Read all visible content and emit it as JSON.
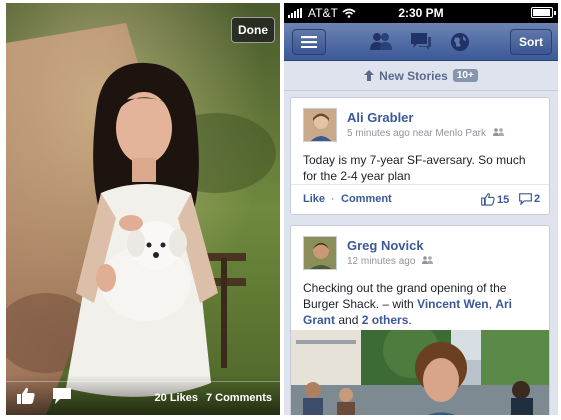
{
  "photo_viewer": {
    "done_label": "Done",
    "likes_text": "20 Likes",
    "comments_text": "7 Comments"
  },
  "status_bar": {
    "carrier": "AT&T",
    "time": "2:30 PM"
  },
  "nav": {
    "sort_label": "Sort",
    "icons": [
      "menu-icon",
      "friends-icon",
      "messages-icon",
      "globe-icon"
    ]
  },
  "banner": {
    "label": "New Stories",
    "count": "10+"
  },
  "feed": {
    "posts": [
      {
        "author": "Ali Grabler",
        "meta": "5 minutes ago near Menlo Park",
        "text": "Today is my 7-year SF-aversary. So much for the 2-4 year plan",
        "like_label": "Like",
        "separator": "·",
        "comment_label": "Comment",
        "likes": "15",
        "comments": "2"
      },
      {
        "author": "Greg Novick",
        "meta": "12 minutes ago",
        "text_prefix": "Checking out the grand opening of the Burger Shack. – with ",
        "tag1": "Vincent Wen",
        "comma": ", ",
        "tag2": "Ari Grant",
        "and": " and ",
        "tag3": "2 others",
        "end": "."
      }
    ]
  },
  "colors": {
    "facebook_blue": "#3b5998",
    "nav_top": "#6d84b4",
    "background": "#dfe3ee"
  }
}
